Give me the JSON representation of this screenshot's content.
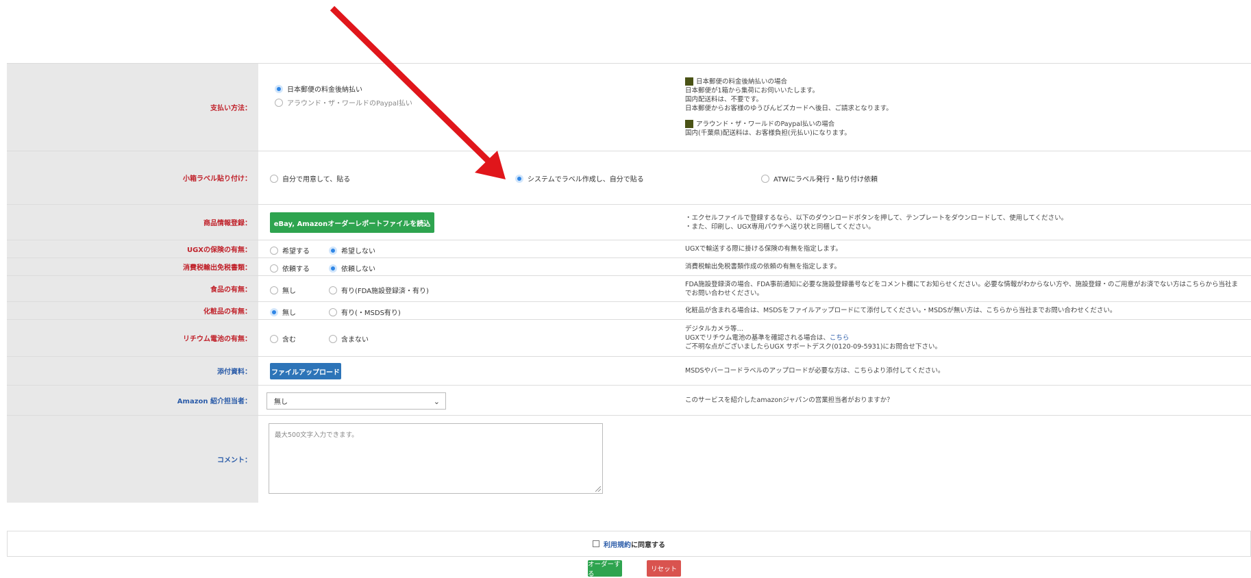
{
  "rows": {
    "payment": {
      "label": "支払い方法：",
      "opt1": "日本郵便の料金後納払い",
      "opt2": "アラウンド・ザ・ワールドのPaypal払い",
      "note_h1": "日本郵便の料金後納払いの場合",
      "note_l1": "日本郵便が1箱から集荷にお伺いいたします。",
      "note_l2": "国内配送料は、不要です。",
      "note_l3": "日本郵便からお客様のゆうびんビズカードへ後日、ご請求となります。",
      "note_h2": "アラウンド・ザ・ワールドのPaypal払いの場合",
      "note_l4": "国内(千葉県)配送料は、お客様負担(元払い)になります。"
    },
    "label": {
      "label": "小箱ラベル貼り付け：",
      "opt1": "自分で用意して、貼る",
      "opt2": "システムでラベル作成し、自分で貼る",
      "opt3": "ATWにラベル発行・貼り付け依頼"
    },
    "product": {
      "label": "商品情報登録：",
      "button": "eBay, Amazonオーダーレポートファイルを読込",
      "note_l1": "・エクセルファイルで登録するなら、以下のダウンロードボタンを押して、テンプレートをダウンロードして、使用してください。",
      "note_l2": "・また、印刷し、UGX専用パウチへ送り状と同梱してください。"
    },
    "insurance": {
      "label": "UGXの保険の有無：",
      "opt1": "希望する",
      "opt2": "希望しない",
      "note": "UGXで輸送する際に掛ける保険の有無を指定します。"
    },
    "tax": {
      "label": "消費税輸出免税書類：",
      "opt1": "依頼する",
      "opt2": "依頼しない",
      "note": "消費税輸出免税書類作成の依頼の有無を指定します。"
    },
    "food": {
      "label": "食品の有無：",
      "opt1": "無し",
      "opt2": "有り(FDA施設登録済・有り)",
      "note": "FDA施設登録済の場合、FDA事前通知に必要な施設登録番号などをコメント欄にてお知らせください。必要な情報がわからない方や、施設登録・のご用意がお済でない方はこちらから当社までお問い合わせください。"
    },
    "cosmetics": {
      "label": "化粧品の有無：",
      "opt1": "無し",
      "opt2": "有り(・MSDS有り)",
      "note": "化粧品が含まれる場合は、MSDSをファイルアップロードにて添付してください。・MSDSが無い方は、こちらから当社までお問い合わせください。"
    },
    "lithium": {
      "label": "リチウム電池の有無：",
      "opt1": "含む",
      "opt2": "含まない",
      "note_l1": "デジタルカメラ等…",
      "note_l2a": "UGXでリチウム電池の基準を確認される場合は、",
      "note_l2_link": "こちら",
      "note_l3": "ご不明な点がございましたらUGX サポートデスク(0120-09-5931)にお問合せ下さい。"
    },
    "attach": {
      "label": "添付資料：",
      "button": "ファイルアップロード",
      "note": "MSDSやバーコードラベルのアップロードが必要な方は、こちらより添付してください。"
    },
    "amazon": {
      "label": "Amazon 紹介担当者：",
      "selected": "無し",
      "note": "このサービスを紹介したamazonジャパンの営業担当者がおりますか？"
    },
    "comment": {
      "label": "コメント：",
      "placeholder": "最大500文字入力できます。"
    }
  },
  "agree": {
    "link": "利用規約",
    "text": "に同意する"
  },
  "buttons": {
    "submit": "オーダーする",
    "reset": "リセット"
  },
  "colors": {
    "label_red": "#c0212a",
    "label_blue": "#2a5ba8",
    "green": "#2ea44f",
    "blue_button": "#2d74b8",
    "reset_red": "#d9534f",
    "arrow": "#e0161b"
  },
  "icons": {
    "arrow": "red-arrow-annotation",
    "select_chevron": "chevron-down-icon"
  }
}
